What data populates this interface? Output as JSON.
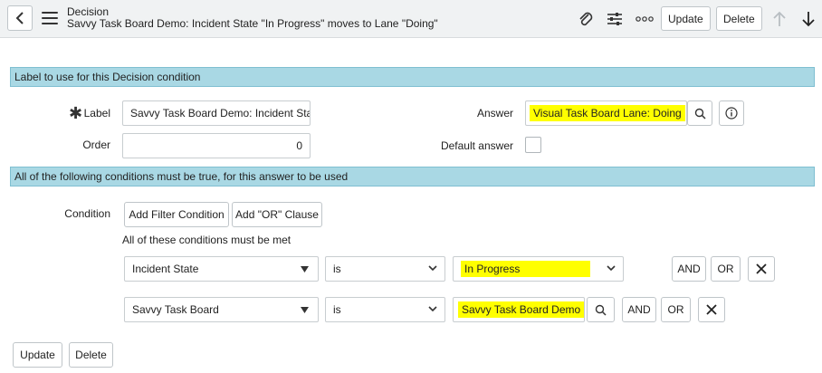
{
  "header": {
    "record_type": "Decision",
    "record_title": "Savvy Task Board Demo: Incident State \"In Progress\" moves to Lane \"Doing\"",
    "update_label": "Update",
    "delete_label": "Delete"
  },
  "sections": {
    "label_section": "Label to use for this Decision condition",
    "conditions_section": "All of the following conditions must be true, for this answer to be used"
  },
  "form": {
    "label_label": "Label",
    "label_value": "Savvy Task Board Demo: Incident State",
    "order_label": "Order",
    "order_value": "0",
    "answer_label": "Answer",
    "answer_value": "Visual Task Board Lane: Doing",
    "default_answer_label": "Default answer",
    "default_answer_checked": false
  },
  "conditions": {
    "label": "Condition",
    "add_filter_label": "Add Filter Condition",
    "add_or_label": "Add \"OR\" Clause",
    "all_met_text": "All of these conditions must be met",
    "rows": [
      {
        "field": "Incident State",
        "operator": "is",
        "value": "In Progress",
        "and_label": "AND",
        "or_label": "OR"
      },
      {
        "field": "Savvy Task Board",
        "operator": "is",
        "value": "Savvy Task Board Demo",
        "and_label": "AND",
        "or_label": "OR"
      }
    ]
  },
  "footer": {
    "update_label": "Update",
    "delete_label": "Delete"
  },
  "colors": {
    "section_bar": "#a9d8e4",
    "highlight": "#ffff00",
    "header_bg": "#f0f2f3"
  }
}
